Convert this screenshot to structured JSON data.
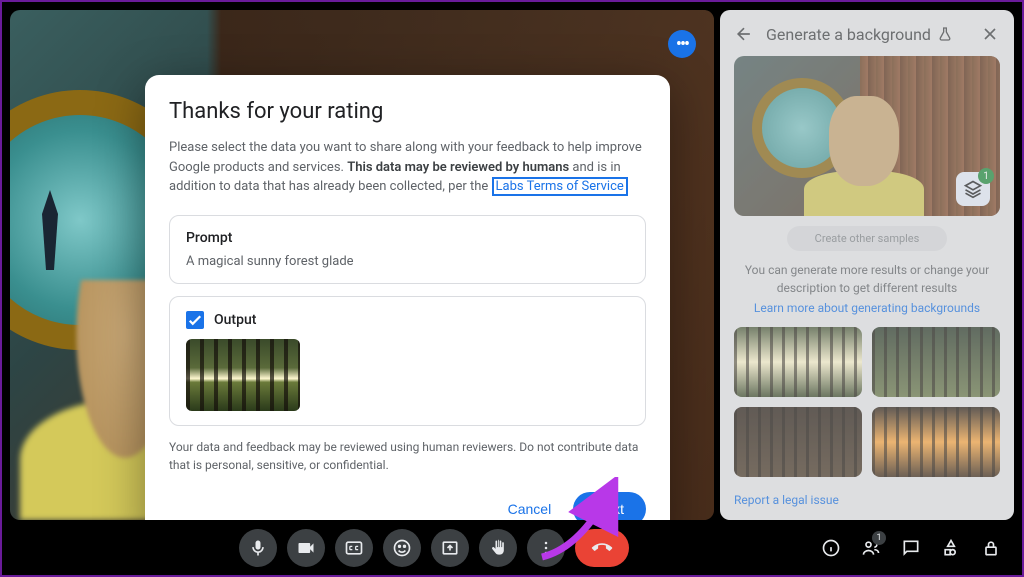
{
  "modal": {
    "title": "Thanks for your rating",
    "desc_part1": "Please select the data you want to share along with your feedback to help improve Google products and services. ",
    "desc_bold": "This data may be reviewed by humans",
    "desc_part2": " and is in addition to data that has already been collected, per the ",
    "tos_link": "Labs Terms of Service",
    "prompt_label": "Prompt",
    "prompt_value": "A magical sunny forest glade",
    "output_label": "Output",
    "output_checked": true,
    "disclaimer": "Your data and feedback may be reviewed using human reviewers. Do not contribute data that is personal, sensitive, or confidential.",
    "cancel": "Cancel",
    "next": "Next"
  },
  "sidebar": {
    "title": "Generate a background",
    "create_chip": "Create other samples",
    "hint": "You can generate more results or change your description to get different results",
    "learn_more": "Learn more about generating backgrounds",
    "layer_count": "1",
    "report": "Report a legal issue"
  },
  "toolbar": {
    "people_count": "1"
  }
}
